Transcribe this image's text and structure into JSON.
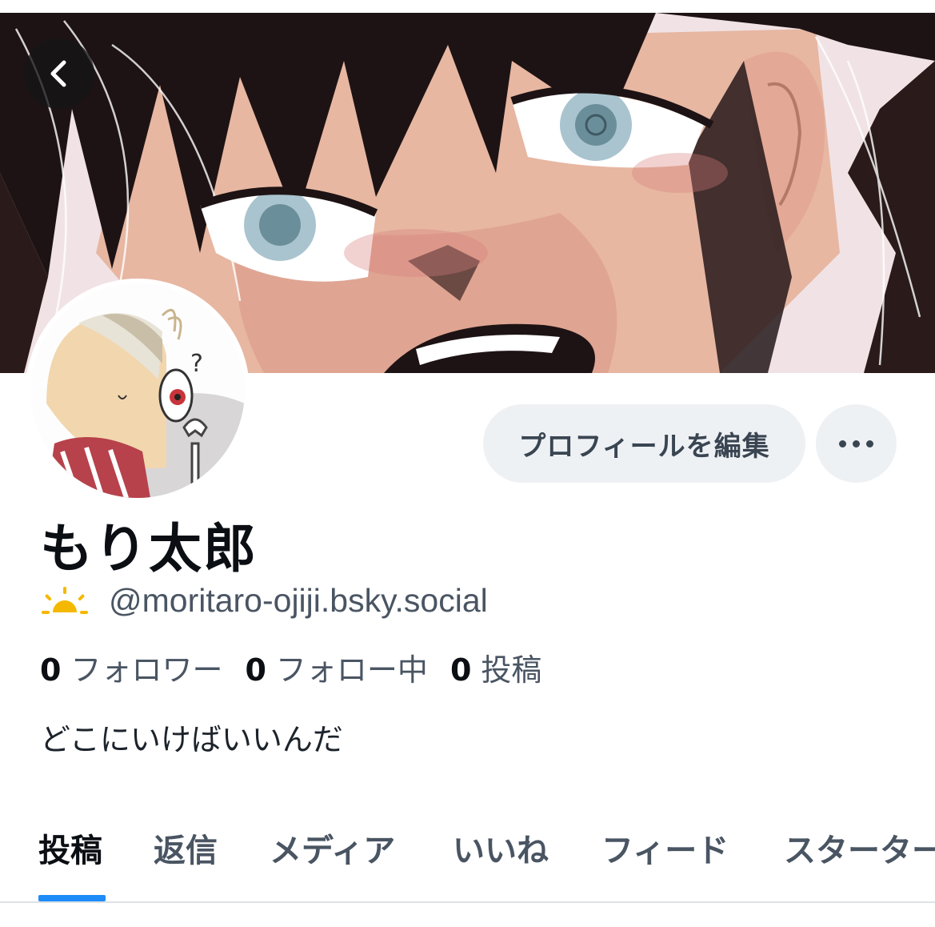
{
  "header": {
    "back_icon": "chevron-left-icon"
  },
  "profile": {
    "display_name": "もり太郎",
    "handle": "@moritaro-ojiji.bsky.social",
    "handle_icon": "sun-icon",
    "bio": "どこにいけばいいんだ",
    "edit_button_label": "プロフィールを編集",
    "more_icon": "more-horizontal-icon"
  },
  "stats": [
    {
      "count": "0",
      "label": "フォロワー"
    },
    {
      "count": "0",
      "label": "フォロー中"
    },
    {
      "count": "0",
      "label": "投稿"
    }
  ],
  "tabs": [
    {
      "label": "投稿",
      "active": true
    },
    {
      "label": "返信",
      "active": false
    },
    {
      "label": "メディア",
      "active": false
    },
    {
      "label": "いいね",
      "active": false
    },
    {
      "label": "フィード",
      "active": false
    },
    {
      "label": "スターターパック",
      "active": false
    }
  ],
  "colors": {
    "accent": "#1d8cf8",
    "button_bg": "#eef1f4",
    "text_primary": "#0b0f14",
    "text_secondary": "#4a5563",
    "sun_icon": "#f5b800"
  }
}
